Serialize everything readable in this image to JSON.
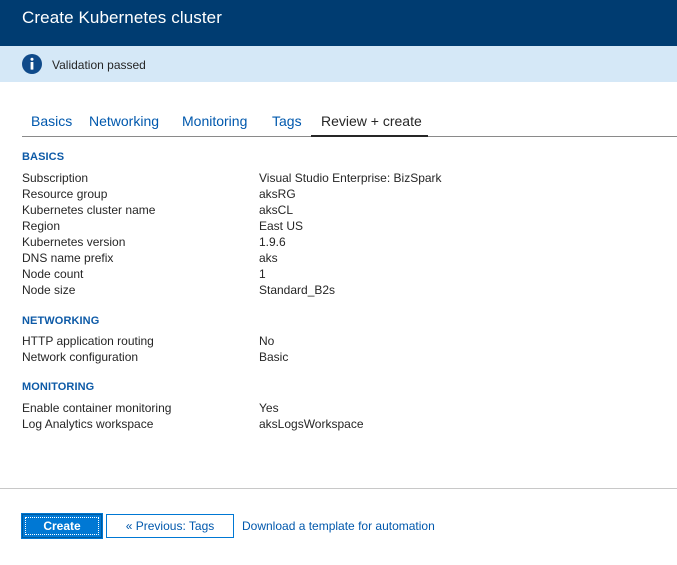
{
  "window": {
    "title": "Create Kubernetes cluster"
  },
  "banner": {
    "icon": "info-icon",
    "message": "Validation passed",
    "bg_color": "#d5e8f7"
  },
  "tabs": [
    {
      "label": "Basics",
      "active": false
    },
    {
      "label": "Networking",
      "active": false
    },
    {
      "label": "Monitoring",
      "active": false
    },
    {
      "label": "Tags",
      "active": false
    },
    {
      "label": "Review + create",
      "active": true
    }
  ],
  "sections": {
    "basics": {
      "heading": "BASICS",
      "rows": [
        {
          "label": "Subscription",
          "value": "Visual Studio Enterprise: BizSpark"
        },
        {
          "label": "Resource group",
          "value": "aksRG"
        },
        {
          "label": "Kubernetes cluster name",
          "value": "aksCL"
        },
        {
          "label": "Region",
          "value": "East US"
        },
        {
          "label": "Kubernetes version",
          "value": "1.9.6"
        },
        {
          "label": "DNS name prefix",
          "value": "aks"
        },
        {
          "label": "Node count",
          "value": "1"
        },
        {
          "label": "Node size",
          "value": "Standard_B2s"
        }
      ]
    },
    "networking": {
      "heading": "NETWORKING",
      "rows": [
        {
          "label": "HTTP application routing",
          "value": "No"
        },
        {
          "label": "Network configuration",
          "value": "Basic"
        }
      ]
    },
    "monitoring": {
      "heading": "MONITORING",
      "rows": [
        {
          "label": "Enable container monitoring",
          "value": "Yes"
        },
        {
          "label": "Log Analytics workspace",
          "value": "aksLogsWorkspace"
        }
      ]
    }
  },
  "footer": {
    "create_label": "Create",
    "previous_label": "« Previous: Tags",
    "download_label": "Download a template for automation"
  },
  "colors": {
    "titlebar": "#003c71",
    "accent": "#0078d4",
    "link": "#0058ad"
  }
}
